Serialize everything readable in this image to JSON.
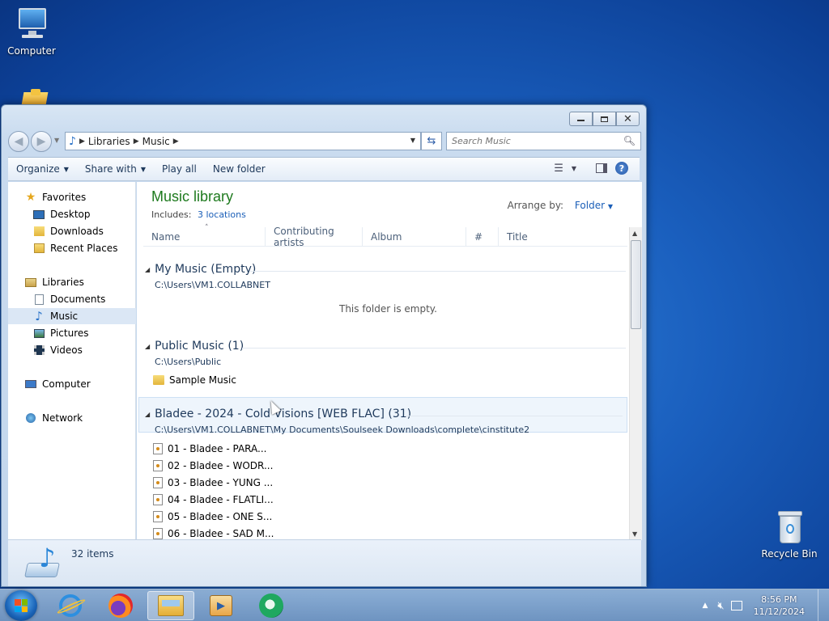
{
  "desktop": {
    "icons": [
      {
        "label": "Computer"
      },
      {
        "label": "Recycle Bin"
      }
    ]
  },
  "window": {
    "address": {
      "crumbs": [
        "Libraries",
        "Music"
      ]
    },
    "search": {
      "placeholder": "Search Music"
    },
    "toolbar": {
      "organize": "Organize",
      "share_with": "Share with",
      "play_all": "Play all",
      "new_folder": "New folder"
    },
    "nav": {
      "favorites": "Favorites",
      "desktop": "Desktop",
      "downloads": "Downloads",
      "recent_places": "Recent Places",
      "libraries": "Libraries",
      "documents": "Documents",
      "music": "Music",
      "pictures": "Pictures",
      "videos": "Videos",
      "computer": "Computer",
      "network": "Network"
    },
    "library": {
      "title": "Music library",
      "includes_label": "Includes:",
      "includes_link": "3 locations",
      "arrange_label": "Arrange by:",
      "arrange_value": "Folder"
    },
    "columns": [
      "Name",
      "Contributing artists",
      "Album",
      "#",
      "Title"
    ],
    "groups": [
      {
        "header": "My Music (Empty)",
        "path": "C:\\Users\\VM1.COLLABNET",
        "empty_message": "This folder is empty."
      },
      {
        "header": "Public Music (1)",
        "path": "C:\\Users\\Public",
        "items": [
          "Sample Music"
        ]
      },
      {
        "header": "Bladee - 2024 - Cold Visions [WEB FLAC] (31)",
        "path": "C:\\Users\\VM1.COLLABNET\\My Documents\\Soulseek Downloads\\complete\\cinstitute2",
        "items": [
          "01 - Bladee - PARA...",
          "02 - Bladee - WODR...",
          "03 - Bladee - YUNG ...",
          "04 - Bladee - FLATLI...",
          "05 - Bladee - ONE S...",
          "06 - Bladee - SAD M..."
        ]
      }
    ],
    "details": {
      "count": "32 items"
    }
  },
  "taskbar": {
    "clock_time": "8:56 PM",
    "clock_date": "11/12/2024"
  }
}
